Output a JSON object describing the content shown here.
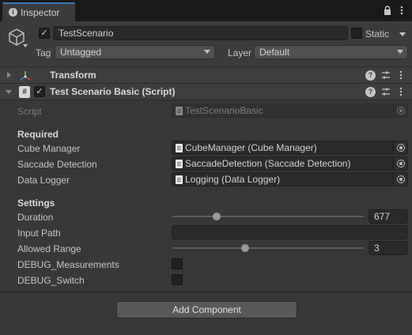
{
  "window": {
    "tab_label": "Inspector"
  },
  "header": {
    "active": true,
    "object_name": "TestScenario",
    "static_label": "Static",
    "static_checked": false,
    "tag_label": "Tag",
    "tag_value": "Untagged",
    "layer_label": "Layer",
    "layer_value": "Default"
  },
  "components": {
    "transform": {
      "title": "Transform",
      "expanded": false
    },
    "script": {
      "title": "Test Scenario Basic (Script)",
      "enabled": true,
      "expanded": true
    }
  },
  "script_field": {
    "label": "Script",
    "value": "TestScenarioBasic"
  },
  "required": {
    "title": "Required",
    "fields": [
      {
        "label": "Cube Manager",
        "value": "CubeManager (Cube Manager)"
      },
      {
        "label": "Saccade Detection",
        "value": "SaccadeDetection (Saccade Detection)"
      },
      {
        "label": "Data Logger",
        "value": "Logging (Data Logger)"
      }
    ]
  },
  "settings": {
    "title": "Settings",
    "duration": {
      "label": "Duration",
      "value": "677",
      "fraction": 0.23
    },
    "input_path": {
      "label": "Input Path",
      "value": ""
    },
    "allowed_range": {
      "label": "Allowed Range",
      "value": "3",
      "fraction": 0.38
    },
    "debug_measurements": {
      "label": "DEBUG_Measurements",
      "checked": false
    },
    "debug_switch": {
      "label": "DEBUG_Switch",
      "checked": false
    }
  },
  "add_component_label": "Add Component",
  "colors": {
    "accent_tab": "#3a79bb",
    "background": "#383838",
    "field": "#2a2a2a"
  }
}
